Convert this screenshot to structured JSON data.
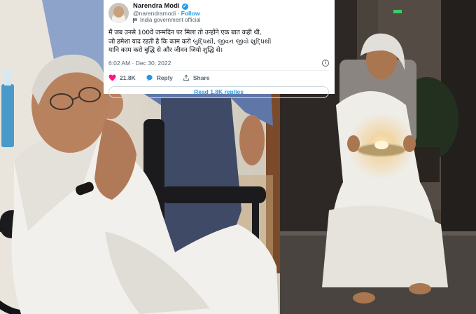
{
  "tweet": {
    "author_name": "Narendra Modi",
    "handle": "@narendramodi",
    "separator": " · ",
    "follow_label": "Follow",
    "account_label": "India government official",
    "body_lines": [
      "मैं जब उनसे 100वें जन्मदिन पर मिला तो उन्होंने एक बात कही थी,",
      "जो हमेशा याद रहती है कि काम करो બુદ્ધિથી, જીવન જીવો શુદ્ધિથી",
      "यानि काम करो बुद्धि से और जीवन जियो शुद्धि से।"
    ],
    "timestamp": "6:02 AM · Dec 30, 2022",
    "likes": "21.8K",
    "reply_label": "Reply",
    "share_label": "Share",
    "read_replies_label": "Read 1.8K replies",
    "icons": [
      "verified-badge-icon",
      "government-flag-icon",
      "info-icon",
      "heart-icon",
      "reply-bubble-icon",
      "share-icon"
    ],
    "colors": {
      "accent": "#1d9bf0",
      "like": "#f91880",
      "text": "#0f1419",
      "muted": "#536471"
    }
  }
}
